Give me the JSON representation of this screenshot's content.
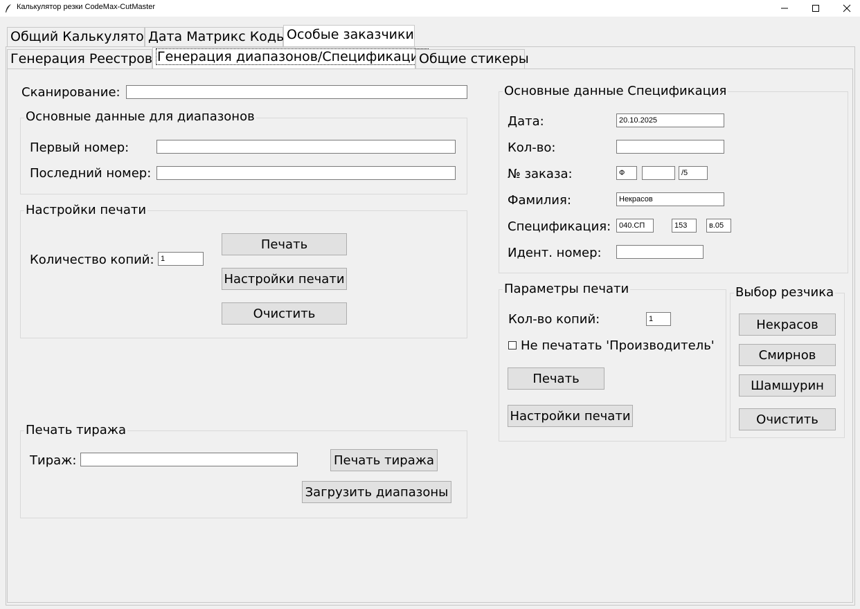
{
  "window": {
    "title": "Калькулятор резки CodeMax-CutMaster"
  },
  "tabs_main": [
    {
      "label": "Общий Калькулятор"
    },
    {
      "label": "Дата Матрикс Коды"
    },
    {
      "label": "Особые заказчики"
    }
  ],
  "tabs_sub": [
    {
      "label": "Генерация Реестров"
    },
    {
      "label": "Генерация диапазонов/Спецификация"
    },
    {
      "label": "Общие стикеры"
    }
  ],
  "scan": {
    "label": "Сканирование:",
    "value": ""
  },
  "ranges": {
    "title": "Основные данные для диапазонов",
    "first_label": "Первый номер:",
    "first_value": "",
    "last_label": "Последний номер:",
    "last_value": ""
  },
  "print_settings": {
    "title": "Настройки печати",
    "copies_label": "Количество копий:",
    "copies_value": "1",
    "print_button": "Печать",
    "settings_button": "Настройки печати",
    "clear_button": "Очистить"
  },
  "circulation": {
    "title": "Печать тиража",
    "label": "Тираж:",
    "value": "",
    "print_button": "Печать тиража",
    "load_button": "Загрузить диапазоны"
  },
  "spec": {
    "title": "Основные данные Спецификация",
    "date_label": "Дата:",
    "date_value": "20.10.2025",
    "qty_label": "Кол-во:",
    "qty_value": "",
    "order_label": "№ заказа:",
    "order_prefix": "Ф",
    "order_number": "",
    "order_suffix": "/5",
    "surname_label": "Фамилия:",
    "surname_value": "Некрасов",
    "spec_label": "Спецификация:",
    "spec_part1": "040.СП",
    "spec_part2": "153",
    "spec_part3": "в.05",
    "ident_label": "Идент. номер:",
    "ident_value": ""
  },
  "print_params": {
    "title": "Параметры печати",
    "copies_label": "Кол-во копий:",
    "copies_value": "1",
    "no_manufacturer_label": "Не печатать 'Производитель'",
    "no_manufacturer_checked": false,
    "print_button": "Печать",
    "settings_button": "Настройки печати"
  },
  "cutter": {
    "title": "Выбор резчика",
    "buttons": [
      "Некрасов",
      "Смирнов",
      "Шамшурин"
    ],
    "clear_button": "Очистить"
  }
}
